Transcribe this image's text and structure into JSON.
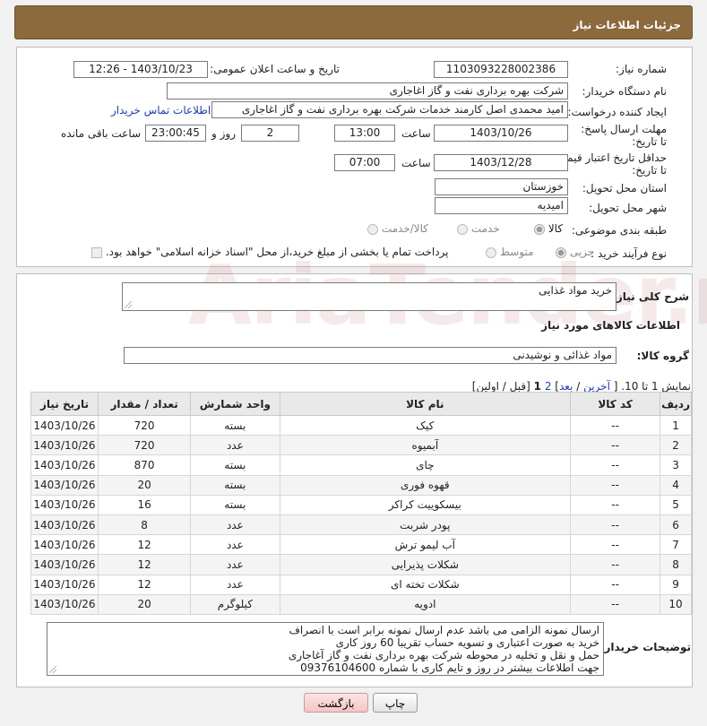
{
  "header": {
    "title": "جزئیات اطلاعات نیاز"
  },
  "form": {
    "need_number_label": "شماره نیاز:",
    "need_number": "1103093228002386",
    "announce_label": "تاریخ و ساعت اعلان عمومی:",
    "announce_value": "1403/10/23 - 12:26",
    "buyer_org_label": "نام دستگاه خریدار:",
    "buyer_org": "شرکت بهره برداری نفت و گاز اغاجاری",
    "creator_label": "ایجاد کننده درخواست:",
    "creator": "امید محمدی اصل کارمند خدمات شرکت بهره برداری نفت و گاز اغاجاری",
    "contact_link": "اطلاعات تماس خریدار",
    "deadline_label": "مهلت ارسال پاسخ: تا تاریخ:",
    "deadline_date": "1403/10/26",
    "time_label": "ساعت",
    "deadline_time": "13:00",
    "days_value": "2",
    "days_label": "روز و",
    "remaining_time": "23:00:45",
    "remaining_label": "ساعت باقی مانده",
    "validity_label": "حداقل تاریخ اعتبار قیمت: تا تاریخ:",
    "validity_date": "1403/12/28",
    "validity_time": "07:00",
    "province_label": "استان محل تحویل:",
    "province": "خوزستان",
    "city_label": "شهر محل تحویل:",
    "city": "امیدیه",
    "category_label": "طبقه بندی موضوعی:",
    "category_options": [
      "کالا",
      "خدمت",
      "کالا/خدمت"
    ],
    "process_label": "نوع فرآیند خرید :",
    "process_options": [
      "جزیی",
      "متوسط"
    ],
    "payment_note": "پرداخت تمام یا بخشی از مبلغ خرید،از محل \"اسناد خزانه اسلامی\" خواهد بود."
  },
  "summary": {
    "title_label": "شرح کلی نیاز:",
    "title_value": "خرید مواد غذایی",
    "items_heading": "اطلاعات کالاهای مورد نیاز",
    "group_label": "گروه کالا:",
    "group_value": "مواد غذائی و نوشیدنی"
  },
  "pagination": {
    "prefix": "نمایش 1 تا 10. [",
    "last": "آخرین",
    "sep": " / ",
    "next": "بعد",
    "page2": "2",
    "page1": "1",
    "suffix": "[قبل / اولین]"
  },
  "table": {
    "headers": [
      "ردیف",
      "کد کالا",
      "نام کالا",
      "واحد شمارش",
      "تعداد / مقدار",
      "تاریخ نیاز"
    ],
    "rows": [
      [
        "1",
        "--",
        "کیک",
        "بسته",
        "720",
        "1403/10/26"
      ],
      [
        "2",
        "--",
        "آبمیوه",
        "عدد",
        "720",
        "1403/10/26"
      ],
      [
        "3",
        "--",
        "چای",
        "بسته",
        "870",
        "1403/10/26"
      ],
      [
        "4",
        "--",
        "قهوه فوری",
        "بسته",
        "20",
        "1403/10/26"
      ],
      [
        "5",
        "--",
        "بیسکوییت کراکر",
        "بسته",
        "16",
        "1403/10/26"
      ],
      [
        "6",
        "--",
        "پودر شربت",
        "عدد",
        "8",
        "1403/10/26"
      ],
      [
        "7",
        "--",
        "آب لیمو ترش",
        "عدد",
        "12",
        "1403/10/26"
      ],
      [
        "8",
        "--",
        "شکلات پذیرایی",
        "عدد",
        "12",
        "1403/10/26"
      ],
      [
        "9",
        "--",
        "شکلات تخته ای",
        "عدد",
        "12",
        "1403/10/26"
      ],
      [
        "10",
        "--",
        "ادویه",
        "کیلوگرم",
        "20",
        "1403/10/26"
      ]
    ]
  },
  "notes": {
    "label": "توضیحات خریدار:",
    "lines": [
      "ارسال نمونه الزامی می باشد عدم ارسال نمونه برابر است با انصراف",
      "خرید به صورت اعتباری و تسویه حساب تقریبا  60 روز کاری",
      "حمل و نقل و تخلیه در محوطه  شرکت بهره برداری نفت و گاز آغاجاری",
      "جهت اطلاعات بیشتر در روز و تایم کاری با شماره 09376104600"
    ]
  },
  "buttons": {
    "print": "چاپ",
    "back": "بازگشت"
  }
}
